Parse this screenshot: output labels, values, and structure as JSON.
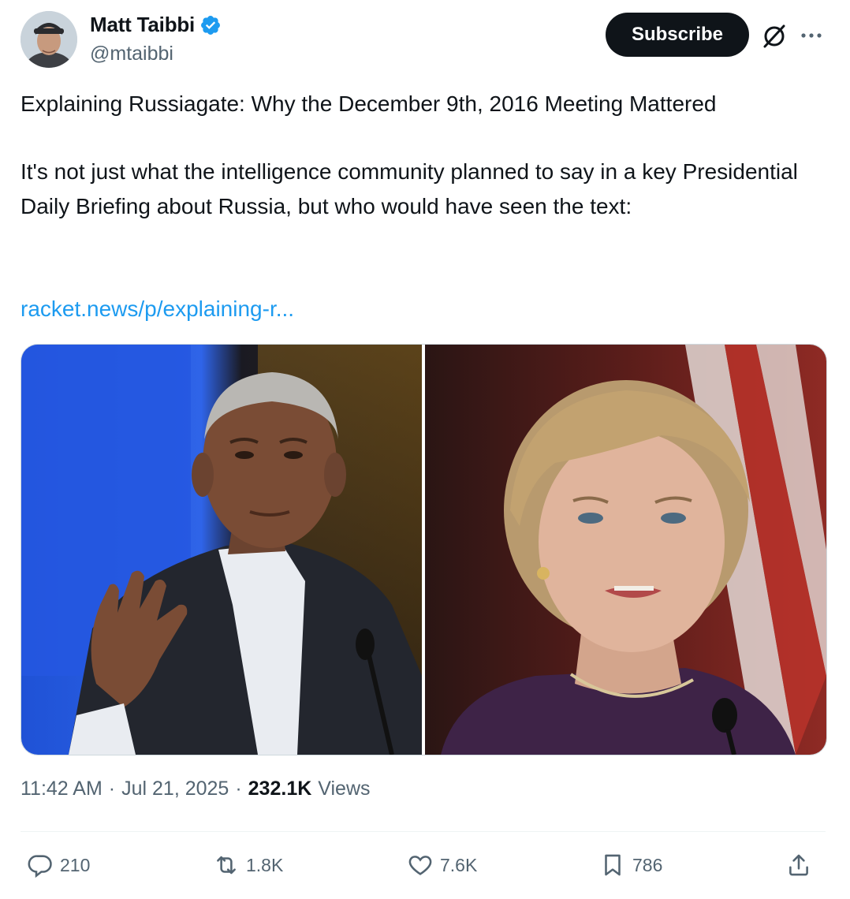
{
  "author": {
    "display_name": "Matt Taibbi",
    "handle": "@mtaibbi",
    "verified": true
  },
  "header": {
    "subscribe_label": "Subscribe",
    "icons": [
      "grok-icon",
      "more-icon"
    ]
  },
  "tweet": {
    "title_line": "Explaining Russiagate: Why the December 9th, 2016 Meeting Mattered",
    "body": "It's not just what the intelligence community planned to say in a key Presidential Daily Briefing about Russia, but who would have seen the text:",
    "link_text": "racket.news/p/explaining-r..."
  },
  "meta": {
    "time": "11:42 AM",
    "separator": "·",
    "date": "Jul 21, 2025",
    "views_count": "232.1K",
    "views_label": "Views"
  },
  "actions": {
    "replies": "210",
    "reposts": "1.8K",
    "likes": "7.6K",
    "bookmarks": "786"
  },
  "colors": {
    "accent": "#1d9bf0",
    "text": "#0f1419",
    "secondary": "#536471",
    "button": "#0f1419"
  }
}
